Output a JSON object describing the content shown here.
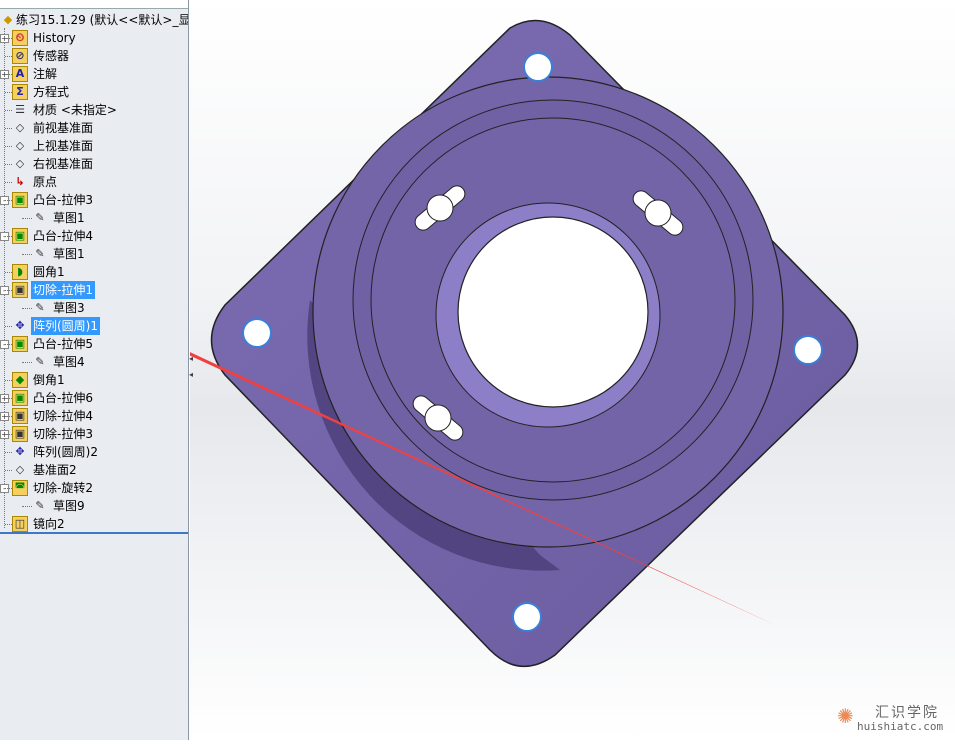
{
  "tree": {
    "root": "练习15.1.29 (默认<<默认>_显示",
    "items": [
      {
        "label": "History",
        "icon": "history-folder-icon",
        "exp": "+",
        "level": 0
      },
      {
        "label": "传感器",
        "icon": "sensor-folder-icon",
        "level": 0
      },
      {
        "label": "注解",
        "icon": "annotation-folder-icon",
        "exp": "+",
        "level": 0
      },
      {
        "label": "方程式",
        "icon": "equation-folder-icon",
        "level": 0
      },
      {
        "label": "材质 <未指定>",
        "icon": "material-icon",
        "level": 0
      },
      {
        "label": "前视基准面",
        "icon": "plane-icon",
        "level": 0
      },
      {
        "label": "上视基准面",
        "icon": "plane-icon",
        "level": 0
      },
      {
        "label": "右视基准面",
        "icon": "plane-icon",
        "level": 0
      },
      {
        "label": "原点",
        "icon": "origin-icon",
        "level": 0
      },
      {
        "label": "凸台-拉伸3",
        "icon": "boss-extrude-icon",
        "exp": "-",
        "level": 0
      },
      {
        "label": "草图1",
        "icon": "sketch-icon",
        "level": 1
      },
      {
        "label": "凸台-拉伸4",
        "icon": "boss-extrude-icon",
        "exp": "-",
        "level": 0
      },
      {
        "label": "草图1",
        "icon": "sketch-icon",
        "level": 1
      },
      {
        "label": "圆角1",
        "icon": "fillet-icon",
        "level": 0
      },
      {
        "label": "切除-拉伸1",
        "icon": "cut-extrude-icon",
        "exp": "-",
        "level": 0,
        "selected": true
      },
      {
        "label": "草图3",
        "icon": "sketch-icon",
        "level": 1
      },
      {
        "label": "阵列(圆周)1",
        "icon": "circular-pattern-icon",
        "level": 0,
        "selected": true
      },
      {
        "label": "凸台-拉伸5",
        "icon": "boss-extrude-icon",
        "exp": "-",
        "level": 0
      },
      {
        "label": "草图4",
        "icon": "sketch-icon",
        "level": 1
      },
      {
        "label": "倒角1",
        "icon": "chamfer-icon",
        "level": 0
      },
      {
        "label": "凸台-拉伸6",
        "icon": "boss-extrude-icon",
        "exp": "+",
        "level": 0
      },
      {
        "label": "切除-拉伸4",
        "icon": "cut-extrude-icon",
        "exp": "+",
        "level": 0
      },
      {
        "label": "切除-拉伸3",
        "icon": "cut-extrude-icon",
        "exp": "+",
        "level": 0
      },
      {
        "label": "阵列(圆周)2",
        "icon": "circular-pattern-icon",
        "level": 0
      },
      {
        "label": "基准面2",
        "icon": "plane-icon",
        "level": 0
      },
      {
        "label": "切除-旋转2",
        "icon": "cut-revolve-icon",
        "exp": "-",
        "level": 0
      },
      {
        "label": "草图9",
        "icon": "sketch-icon",
        "level": 1
      },
      {
        "label": "镜向2",
        "icon": "mirror-icon",
        "level": 0
      }
    ]
  },
  "colors": {
    "part": "#7666aa",
    "selection": "#3399ff",
    "arrow": "#f04040"
  },
  "watermark": {
    "name": "汇识学院",
    "url": "huishiatc.com"
  }
}
